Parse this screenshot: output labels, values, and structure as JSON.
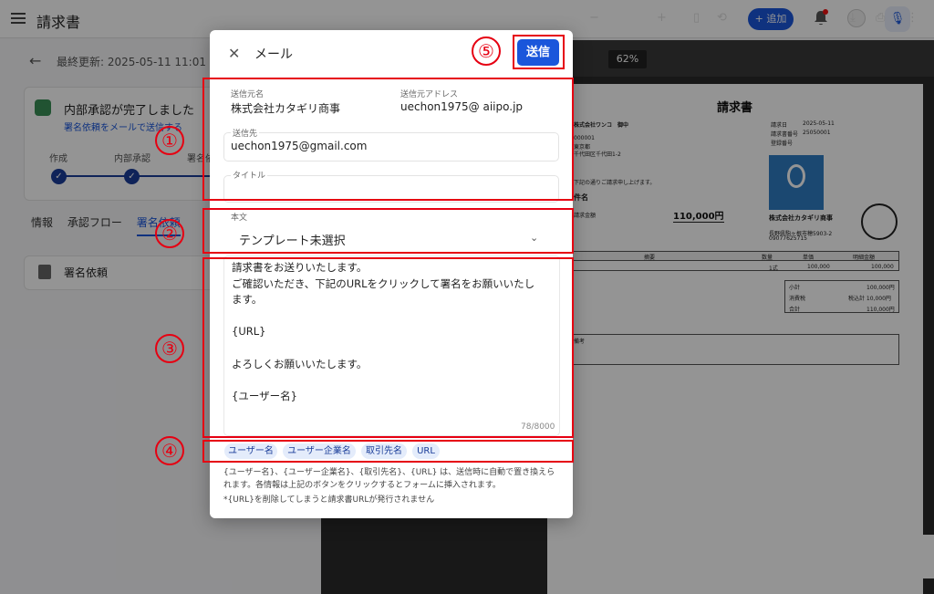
{
  "app": {
    "title": "請求書",
    "add_button": "+ 追加"
  },
  "left_panel": {
    "last_updated": "最終更新: 2025-05-11 11:01",
    "status_title": "内部承認が完了しました",
    "status_link": "署名依頼をメールで送信する",
    "steps": [
      "作成",
      "内部承認",
      "署名依"
    ],
    "tabs": [
      "情報",
      "承認フロー",
      "署名依頼"
    ],
    "sign_card_label": "署名依頼"
  },
  "pdf_viewer": {
    "zoom": "62%",
    "invoice": {
      "title": "請求書",
      "customer": "株式会社ワンコ　御中",
      "issue_date_label": "請求日",
      "issue_date": "2025-05-11",
      "invoice_no_label": "請求書番号",
      "invoice_no": "25050001",
      "registration_label": "登録番号",
      "postal": "000001",
      "address1": "東京都",
      "address2": "千代田区千代田1-2",
      "intro": "下記の通りご請求申し上げます。",
      "subject_label": "件名",
      "total_label": "請求金額",
      "total": "110,000円",
      "company": "株式会社カタギリ商事",
      "company_address": "長野県駒ヶ根市穂5903-2",
      "company_phone": "09077625715",
      "table_headers": [
        "摘要",
        "数量",
        "単価",
        "明細金額"
      ],
      "row": [
        "",
        "1式",
        "100,000",
        "100,000"
      ],
      "subtotal_label": "小計",
      "subtotal": "100,000円",
      "tax_label": "消費税",
      "tax": "税込計 10,000円",
      "grand_total_label": "合計",
      "grand_total": "110,000円",
      "memo_label": "備考"
    }
  },
  "modal": {
    "title": "メール",
    "send_button": "送信",
    "sender_name_label": "送信元名",
    "sender_name": "株式会社カタギリ商事",
    "sender_address_label": "送信元アドレス",
    "sender_address": "uechon1975@ aiipo.jp",
    "recipient_label": "送信先",
    "recipient": "uechon1975@gmail.com",
    "subject_label": "タイトル",
    "subject": "",
    "body_label": "本文",
    "template_select": "テンプレート未選択",
    "body_lines": [
      "請求書をお送りいたします。",
      "ご確認いただき、下記のURLをクリックして署名をお願いいたし",
      "ます。",
      "",
      "{URL}",
      "",
      "よろしくお願いいたします。",
      "",
      "{ユーザー名}"
    ],
    "char_counter": "78/8000",
    "chips": [
      "ユーザー名",
      "ユーザー企業名",
      "取引先名",
      "URL"
    ],
    "notes": [
      "{ユーザー名}、{ユーザー企業名}、{取引先名}、{URL} は、送信時に自動で置き換えら",
      "れます。各情報は上記のボタンをクリックするとフォームに挿入されます。",
      "*{URL}を削除してしまうと請求書URLが発行されません"
    ]
  },
  "annotations": [
    "①",
    "②",
    "③",
    "④",
    "⑤"
  ],
  "colors": {
    "accent": "#1a56db",
    "annotation_red": "#e60012"
  }
}
